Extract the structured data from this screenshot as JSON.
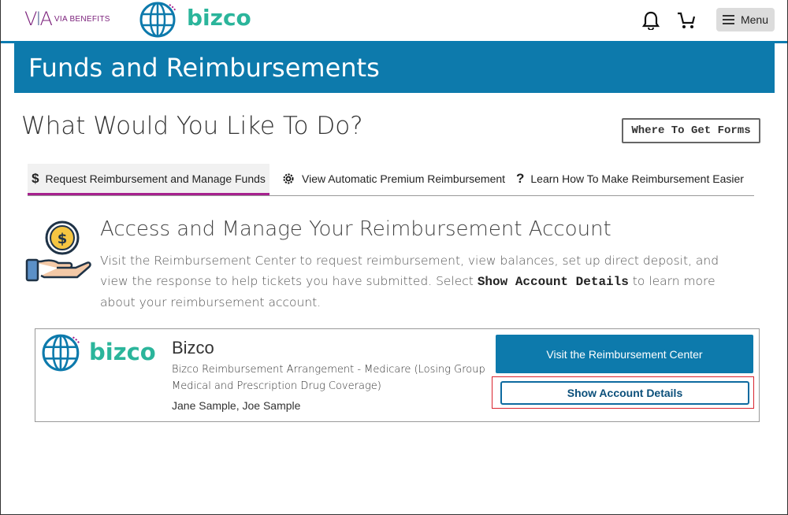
{
  "header": {
    "via_logo_text": "VIA BENEFITS",
    "brand_name": "bizco",
    "menu_label": "Menu",
    "icons": [
      "bell-icon",
      "cart-icon",
      "hamburger-icon"
    ]
  },
  "banner": {
    "title": "Funds and Reimbursements"
  },
  "page": {
    "question": "What Would You Like To Do?",
    "forms_button": "Where To Get Forms"
  },
  "tabs": [
    {
      "icon": "$",
      "label": "Request Reimbursement and Manage Funds",
      "active": true
    },
    {
      "icon": "gear-icon",
      "label": "View Automatic Premium Reimbursement",
      "active": false
    },
    {
      "icon": "?",
      "label": "Learn How To Make Reimbursement Easier",
      "active": false
    }
  ],
  "section": {
    "title": "Access and Manage Your Reimbursement Account",
    "desc_before": "Visit the Reimbursement Center to request reimbursement, view balances, set up direct deposit, and view the response to help tickets you have submitted. Select ",
    "desc_emphasis": "Show Account Details",
    "desc_after": " to learn more about your reimbursement account."
  },
  "card": {
    "logo_text": "bizco",
    "name": "Bizco",
    "plan": "Bizco Reimbursement Arrangement - Medicare (Losing Group Medical and Prescription Drug Coverage)",
    "members": "Jane Sample, Joe Sample",
    "visit_button": "Visit the Reimbursement Center",
    "details_button": "Show Account Details"
  },
  "colors": {
    "banner": "#0d7aac",
    "brand_green": "#2bb59b",
    "active_tab_underline": "#a6218e",
    "highlight_red": "#d9232d"
  }
}
